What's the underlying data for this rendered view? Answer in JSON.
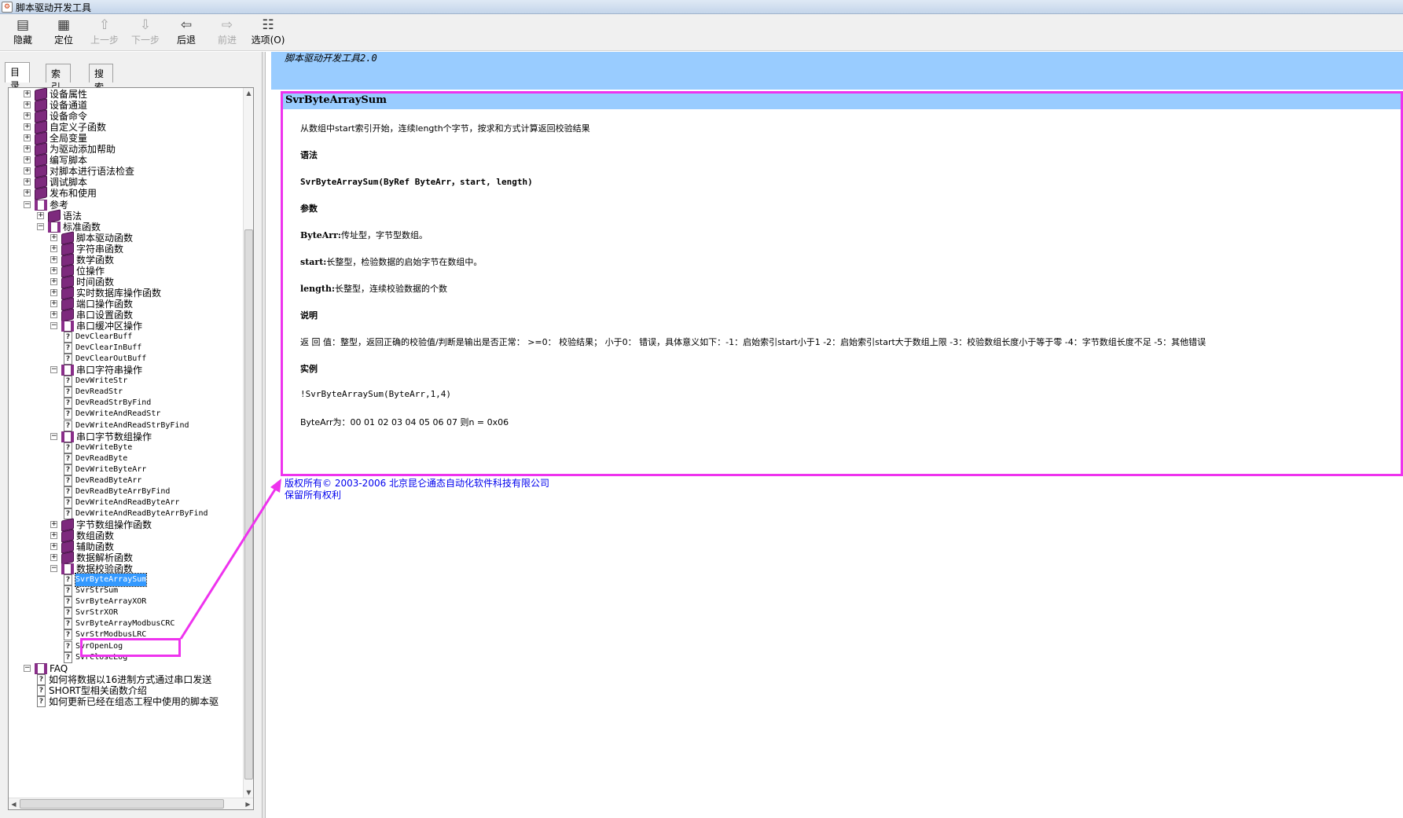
{
  "window": {
    "title": "脚本驱动开发工具"
  },
  "toolbar": [
    {
      "id": "hide",
      "label": "隐藏",
      "icon": "hide-icon",
      "glyph": "▤",
      "enabled": true
    },
    {
      "id": "locate",
      "label": "定位",
      "icon": "locate-icon",
      "glyph": "▦",
      "enabled": true
    },
    {
      "id": "prev-step",
      "label": "上一步",
      "icon": "up-arrow-icon",
      "glyph": "⇧",
      "enabled": false
    },
    {
      "id": "next-step",
      "label": "下一步",
      "icon": "down-arrow-icon",
      "glyph": "⇩",
      "enabled": false
    },
    {
      "id": "back",
      "label": "后退",
      "icon": "back-arrow-icon",
      "glyph": "⇦",
      "enabled": true
    },
    {
      "id": "forward",
      "label": "前进",
      "icon": "forward-arrow-icon",
      "glyph": "⇨",
      "enabled": false
    },
    {
      "id": "options",
      "label": "选项(O)",
      "icon": "options-icon",
      "glyph": "☷",
      "enabled": true
    }
  ],
  "tabs": [
    {
      "label": "目录(C)",
      "active": true
    },
    {
      "label": "索引(N)",
      "active": false
    },
    {
      "label": "搜索(S)",
      "active": false
    }
  ],
  "tree": [
    {
      "level": 0,
      "type": "book",
      "expander": "+",
      "label": "设备属性"
    },
    {
      "level": 0,
      "type": "book",
      "expander": "+",
      "label": "设备通道"
    },
    {
      "level": 0,
      "type": "book",
      "expander": "+",
      "label": "设备命令"
    },
    {
      "level": 0,
      "type": "book",
      "expander": "+",
      "label": "自定义子函数"
    },
    {
      "level": 0,
      "type": "book",
      "expander": "+",
      "label": "全局变量"
    },
    {
      "level": 0,
      "type": "book",
      "expander": "+",
      "label": "为驱动添加帮助"
    },
    {
      "level": 0,
      "type": "book",
      "expander": "+",
      "label": "编写脚本"
    },
    {
      "level": 0,
      "type": "book",
      "expander": "+",
      "label": "对脚本进行语法检查"
    },
    {
      "level": 0,
      "type": "book",
      "expander": "+",
      "label": "调试脚本"
    },
    {
      "level": 0,
      "type": "book",
      "expander": "+",
      "label": "发布和使用"
    },
    {
      "level": 0,
      "type": "open",
      "expander": "−",
      "label": "参考"
    },
    {
      "level": 1,
      "type": "book",
      "expander": "+",
      "label": "语法"
    },
    {
      "level": 1,
      "type": "open",
      "expander": "−",
      "label": "标准函数"
    },
    {
      "level": 2,
      "type": "book",
      "expander": "+",
      "label": "脚本驱动函数"
    },
    {
      "level": 2,
      "type": "book",
      "expander": "+",
      "label": "字符串函数"
    },
    {
      "level": 2,
      "type": "book",
      "expander": "+",
      "label": "数学函数"
    },
    {
      "level": 2,
      "type": "book",
      "expander": "+",
      "label": "位操作"
    },
    {
      "level": 2,
      "type": "book",
      "expander": "+",
      "label": "时间函数"
    },
    {
      "level": 2,
      "type": "book",
      "expander": "+",
      "label": "实时数据库操作函数"
    },
    {
      "level": 2,
      "type": "book",
      "expander": "+",
      "label": "端口操作函数"
    },
    {
      "level": 2,
      "type": "book",
      "expander": "+",
      "label": "串口设置函数"
    },
    {
      "level": 2,
      "type": "open",
      "expander": "−",
      "label": "串口缓冲区操作"
    },
    {
      "level": 3,
      "type": "page",
      "label": "DevClearBuff"
    },
    {
      "level": 3,
      "type": "page",
      "label": "DevClearInBuff"
    },
    {
      "level": 3,
      "type": "page",
      "label": "DevClearOutBuff"
    },
    {
      "level": 2,
      "type": "open",
      "expander": "−",
      "label": "串口字符串操作"
    },
    {
      "level": 3,
      "type": "page",
      "label": "DevWriteStr"
    },
    {
      "level": 3,
      "type": "page",
      "label": "DevReadStr"
    },
    {
      "level": 3,
      "type": "page",
      "label": "DevReadStrByFind"
    },
    {
      "level": 3,
      "type": "page",
      "label": "DevWriteAndReadStr"
    },
    {
      "level": 3,
      "type": "page",
      "label": "DevWriteAndReadStrByFind"
    },
    {
      "level": 2,
      "type": "open",
      "expander": "−",
      "label": "串口字节数组操作"
    },
    {
      "level": 3,
      "type": "page",
      "label": "DevWriteByte"
    },
    {
      "level": 3,
      "type": "page",
      "label": "DevReadByte"
    },
    {
      "level": 3,
      "type": "page",
      "label": "DevWriteByteArr"
    },
    {
      "level": 3,
      "type": "page",
      "label": "DevReadByteArr"
    },
    {
      "level": 3,
      "type": "page",
      "label": "DevReadByteArrByFind"
    },
    {
      "level": 3,
      "type": "page",
      "label": "DevWriteAndReadByteArr"
    },
    {
      "level": 3,
      "type": "page",
      "label": "DevWriteAndReadByteArrByFind"
    },
    {
      "level": 2,
      "type": "book",
      "expander": "+",
      "label": "字节数组操作函数"
    },
    {
      "level": 2,
      "type": "book",
      "expander": "+",
      "label": "数组函数"
    },
    {
      "level": 2,
      "type": "book",
      "expander": "+",
      "label": "辅助函数"
    },
    {
      "level": 2,
      "type": "book",
      "expander": "+",
      "label": "数据解析函数"
    },
    {
      "level": 2,
      "type": "open",
      "expander": "−",
      "label": "数据校验函数"
    },
    {
      "level": 3,
      "type": "page",
      "label": "SvrByteArraySum",
      "selected": true
    },
    {
      "level": 3,
      "type": "page",
      "label": "SvrStrSum"
    },
    {
      "level": 3,
      "type": "page",
      "label": "SvrByteArrayXOR"
    },
    {
      "level": 3,
      "type": "page",
      "label": "SvrStrXOR"
    },
    {
      "level": 3,
      "type": "page",
      "label": "SvrByteArrayModbusCRC"
    },
    {
      "level": 3,
      "type": "page",
      "label": "SvrStrModbusLRC"
    },
    {
      "level": 3,
      "type": "page",
      "label": "SvrOpenLog"
    },
    {
      "level": 3,
      "type": "page",
      "label": "SvrCloseLog"
    },
    {
      "level": 0,
      "type": "open",
      "expander": "−",
      "label": "FAQ"
    },
    {
      "level": 1,
      "type": "page",
      "label": "如何将数据以16进制方式通过串口发送"
    },
    {
      "level": 1,
      "type": "page",
      "label": "SHORT型相关函数介绍"
    },
    {
      "level": 1,
      "type": "page",
      "label": "如何更新已经在组态工程中使用的脚本驱"
    }
  ],
  "content": {
    "banner_title": "脚本驱动开发工具2.0",
    "topic_title": "SvrByteArraySum",
    "description": "从数组中start索引开始，连续length个字节，按求和方式计算返回校验结果",
    "syntax_heading": "语法",
    "syntax": "SvrByteArraySum(ByRef ByteArr，start, length)",
    "params_heading": "参数",
    "params": [
      {
        "name": "ByteArr:",
        "desc": "传址型，字节型数组。"
      },
      {
        "name": "start:",
        "desc": "长整型，检验数据的启始字节在数组中。"
      },
      {
        "name": "length:",
        "desc": "长整型，连续校验数据的个数"
      }
    ],
    "remarks_heading": "说明",
    "remarks": "返 回 值：整型，返回正确的校验值/判断是输出是否正常： >=0： 校验结果； 小于0： 错误，具体意义如下：-1：启始索引start小于1 -2：启始索引start大于数组上限 -3：校验数组长度小于等于零 -4：字节数组长度不足 -5：其他错误",
    "example_heading": "实例",
    "example_call": "!SvrByteArraySum(ByteArr,1,4)",
    "example_result": "ByteArr为：00 01 02 03 04 05 06 07 则n = 0x06",
    "copyright": "版权所有© 2003-2006 北京昆仑通态自动化软件科技有限公司",
    "rights": "保留所有权利"
  },
  "colors": {
    "banner": "#99ccff",
    "highlight": "#ee33ee",
    "selection": "#3399ff",
    "link": "#0000ee"
  }
}
